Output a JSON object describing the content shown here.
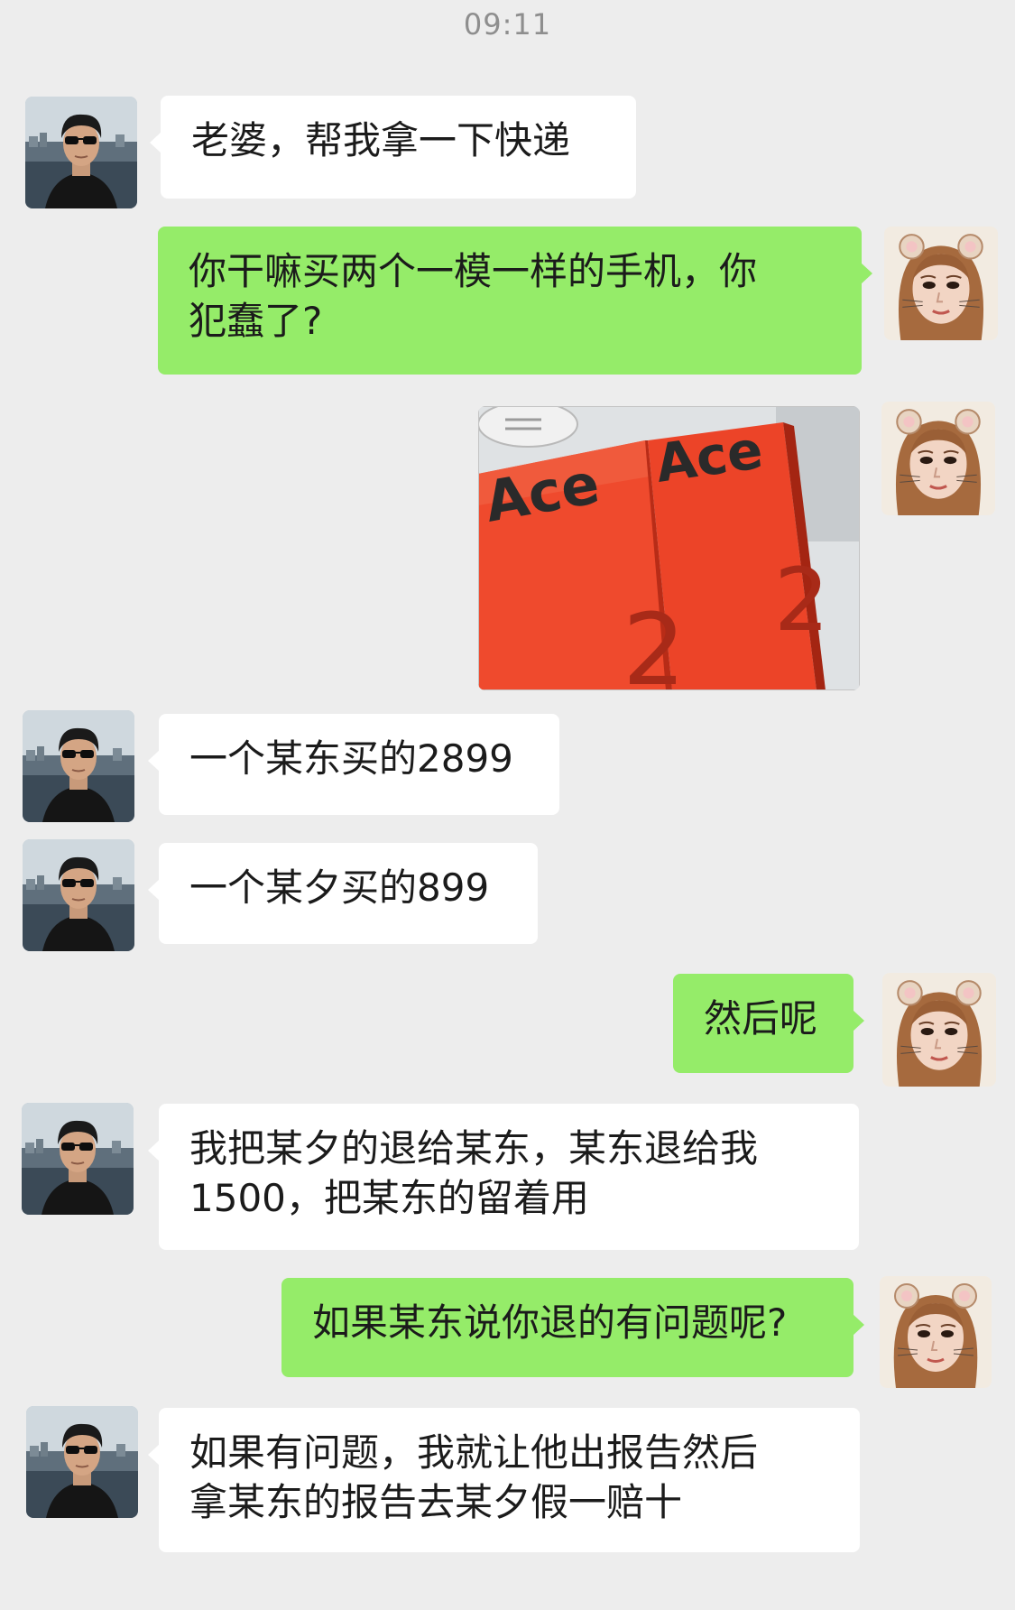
{
  "status": {
    "time": "09:11"
  },
  "photo": {
    "box_left_text": "Ace",
    "box_right_text": "Ace",
    "box_number": "2"
  },
  "messages": [
    {
      "sender": "husband",
      "text": "老婆，帮我拿一下快递"
    },
    {
      "sender": "wife",
      "text": "你干嘛买两个一模一样的手机，你\n犯蠢了?"
    },
    {
      "sender": "wife",
      "type": "image"
    },
    {
      "sender": "husband",
      "text": "一个某东买的2899"
    },
    {
      "sender": "husband",
      "text": "一个某夕买的899"
    },
    {
      "sender": "wife",
      "text": "然后呢"
    },
    {
      "sender": "husband",
      "text": "我把某夕的退给某东，某东退给我\n1500，把某东的留着用"
    },
    {
      "sender": "wife",
      "text": "如果某东说你退的有问题呢?"
    },
    {
      "sender": "husband",
      "text": "如果有问题，我就让他出报告然后\n拿某东的报告去某夕假一赔十"
    }
  ],
  "colors": {
    "background": "#ededed",
    "incoming_bubble": "#ffffff",
    "outgoing_bubble": "#95ec69",
    "box_orange": "#ef4a2d"
  },
  "icons": {
    "husband_avatar": "man-sunglasses-avatar-icon",
    "wife_avatar": "woman-cat-filter-avatar-icon"
  }
}
